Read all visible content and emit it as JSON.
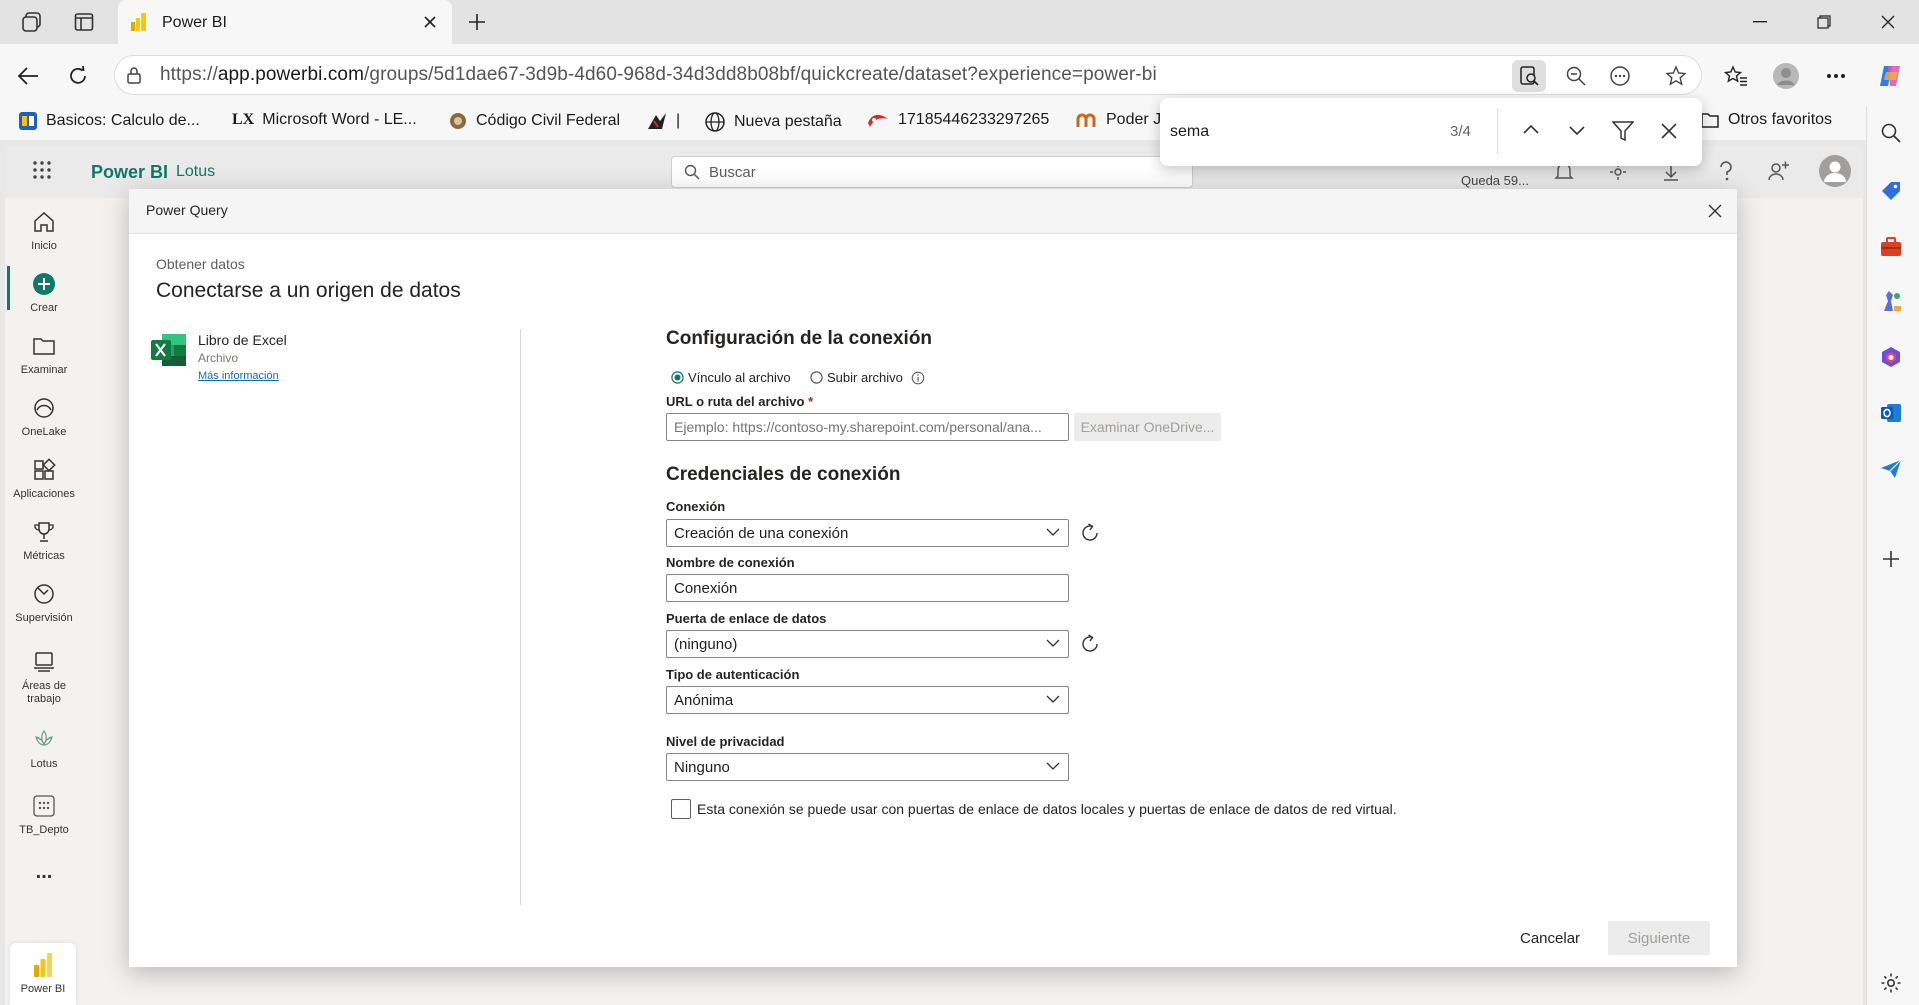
{
  "browser": {
    "tab_title": "Power BI",
    "url_prefix": "https://",
    "url_host": "app.powerbi.com",
    "url_path": "/groups/5d1dae67-3d9b-4d60-968d-34d3dd8b08bf/quickcreate/dataset?experience=power-bi",
    "bookmarks": [
      {
        "label": "Basicos: Calculo de..."
      },
      {
        "label": "Microsoft Word - LE..."
      },
      {
        "label": "Código Civil Federal"
      },
      {
        "label": "|"
      },
      {
        "label": "Nueva pestaña"
      },
      {
        "label": "17185446233297265"
      },
      {
        "label": "Poder J"
      }
    ],
    "other_favorites": "Otros favoritos"
  },
  "find": {
    "query": "sema",
    "count": "3/4"
  },
  "pbi": {
    "app_name": "Power BI",
    "workspace": "Lotus",
    "search_placeholder": "Buscar",
    "trial_text": "Queda 59..."
  },
  "left_nav": [
    {
      "label": "Inicio",
      "icon": "home-icon"
    },
    {
      "label": "Crear",
      "icon": "add-circle-icon"
    },
    {
      "label": "Examinar",
      "icon": "folder-icon"
    },
    {
      "label": "OneLake",
      "icon": "onelake-icon"
    },
    {
      "label": "Aplicaciones",
      "icon": "apps-icon"
    },
    {
      "label": "Métricas",
      "icon": "trophy-icon"
    },
    {
      "label": "Supervisión",
      "icon": "monitor-icon"
    },
    {
      "label": "Áreas de trabajo",
      "icon": "workspaces-icon"
    },
    {
      "label": "Lotus",
      "icon": "lotus-icon"
    },
    {
      "label": "TB_Depto",
      "icon": "dataset-icon"
    },
    {
      "label": "...",
      "icon": "more-icon"
    },
    {
      "label": "Power BI",
      "icon": "powerbi-logo"
    }
  ],
  "modal": {
    "title": "Power Query",
    "breadcrumb": "Obtener datos",
    "heading": "Conectarse a un origen de datos",
    "source": {
      "name": "Libro de Excel",
      "type": "Archivo",
      "more_link": "Más información"
    },
    "connection_settings": {
      "title": "Configuración de la conexión",
      "radio_link": "Vínculo al archivo",
      "radio_upload": "Subir archivo",
      "selected_radio": "link",
      "url_label": "URL o ruta del archivo",
      "required_mark": "*",
      "url_placeholder": "Ejemplo: https://contoso-my.sharepoint.com/personal/ana...",
      "browse_button": "Examinar OneDrive..."
    },
    "credentials": {
      "title": "Credenciales de conexión",
      "connection_label": "Conexión",
      "connection_value": "Creación de una conexión",
      "connection_name_label": "Nombre de conexión",
      "connection_name_value": "Conexión",
      "gateway_label": "Puerta de enlace de datos",
      "gateway_value": "(ninguno)",
      "auth_label": "Tipo de autenticación",
      "auth_value": "Anónima",
      "privacy_label": "Nivel de privacidad",
      "privacy_value": "Ninguno",
      "checkbox_label": "Esta conexión se puede usar con puertas de enlace de datos locales y puertas de enlace de datos de red virtual.",
      "checkbox_checked": false
    },
    "cancel_button": "Cancelar",
    "next_button": "Siguiente"
  },
  "colors": {
    "pbi_yellow": "#f2c811",
    "excel_green": "#107c41",
    "pbi_green": "#117865",
    "link_blue": "#0f6cbd"
  }
}
